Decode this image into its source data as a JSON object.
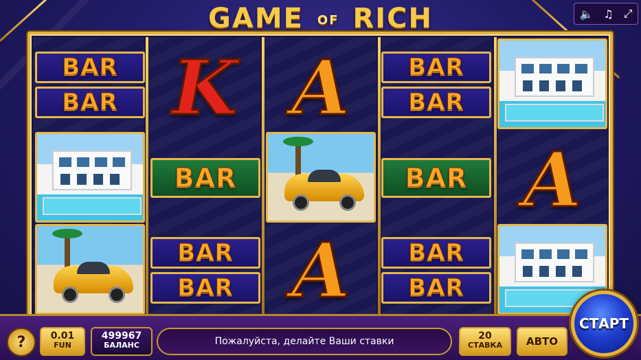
{
  "title": {
    "game": "GAME",
    "of": "OF",
    "rich": "RICH"
  },
  "system_icons": [
    "speaker-icon",
    "music-icon",
    "fullscreen-icon"
  ],
  "symbols": {
    "bar": "BAR",
    "k": "K",
    "a": "A"
  },
  "controls": {
    "help": "?",
    "coin_value": "0.01",
    "coin_label": "FUN",
    "balance_value": "499967",
    "balance_label": "БАЛАНС",
    "message": "Пожалуйста, делайте Ваши ставки",
    "bet_value": "20",
    "bet_label": "СТАВКА",
    "auto": "АВТО",
    "start": "СТАРТ"
  },
  "colors": {
    "accent_gold": "#e2b23e",
    "background": "#1a1650",
    "start_blue": "#1f3fd0"
  }
}
